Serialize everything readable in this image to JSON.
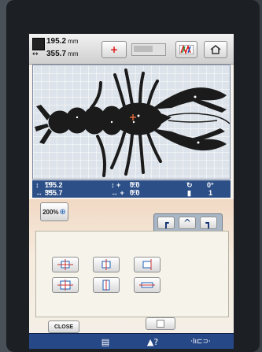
{
  "header": {
    "width_value": "195.2",
    "height_value": "355.7",
    "unit": "mm",
    "plus_label": "+"
  },
  "info": {
    "width_value": "195.2",
    "height_value": "355.7",
    "x_offset": "0.0",
    "y_offset": "0.0",
    "unit": "mm",
    "rotation": "0°",
    "color_count": "1"
  },
  "toolbar": {
    "zoom_label": "200%"
  },
  "dirpad": {
    "up": "^",
    "down": "v",
    "left": "<",
    "right": ">",
    "center": "•"
  },
  "footer": {
    "close_label": "CLOSE",
    "help_label": "?"
  },
  "colors": {
    "accent": "#2c4f88",
    "background": "#f7f3ec"
  }
}
